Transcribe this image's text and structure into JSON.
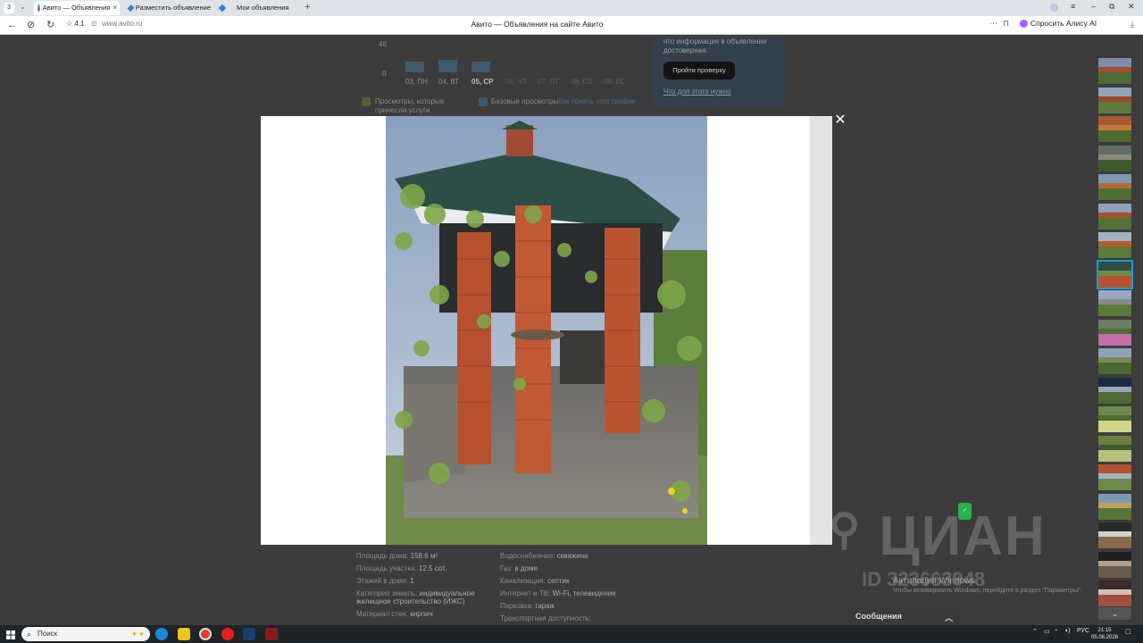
{
  "browser": {
    "tab_count": "3",
    "tabs": [
      {
        "label": "Авито — Объявления",
        "active": true
      },
      {
        "label": "Разместить объявление"
      },
      {
        "label": "Мои объявления"
      }
    ],
    "rating": "4.1",
    "url": "www.avito.ru",
    "page_title": "Авито — Объявления на сайте Авито",
    "alice_label": "Спросить Алису AI"
  },
  "background_page": {
    "chart_y_top": "46",
    "chart_y_zero": "0",
    "days": [
      "03, ПН",
      "04, ВТ",
      "05, СР",
      "06, ЧТ",
      "07, ПТ",
      "08, СБ",
      "09, ВС"
    ],
    "legend_paid": "Просмотры, которые принесли услуги",
    "legend_base": "Базовые просмотры",
    "legend_link": "Как понять этот график",
    "tip_text": "что информация в объявлении достоверная.",
    "check_button": "Пройти проверку",
    "check_link": "Что для этого нужно",
    "specs_left": [
      {
        "label": "Площадь дома:",
        "value": "158.6 м²"
      },
      {
        "label": "Площадь участка:",
        "value": "12.5 сот."
      },
      {
        "label": "Этажей в доме:",
        "value": "1"
      },
      {
        "label": "Категория земель:",
        "value": "индивидуальное жилищное строительство (ИЖС)"
      },
      {
        "label": "Материал стен:",
        "value": "кирпич"
      }
    ],
    "specs_right": [
      {
        "label": "Водоснабжение:",
        "value": "скважина"
      },
      {
        "label": "Газ:",
        "value": "в доме"
      },
      {
        "label": "Канализация:",
        "value": "септик"
      },
      {
        "label": "Интернет и ТВ:",
        "value": "Wi-Fi, телевидение"
      },
      {
        "label": "Парковка:",
        "value": "гараж"
      },
      {
        "label": "Транспортная доступность:",
        "value": ""
      }
    ]
  },
  "overlay": {
    "cian_watermark": "ЦИАН",
    "cian_id": "ID 323663948",
    "windows_activation": "Активация Windows",
    "windows_activation_sub": "Чтобы активировать Windows, перейдите в раздел \"Параметры\".",
    "messages_label": "Сообщения"
  },
  "taskbar": {
    "search_label": "Поиск",
    "lang": "РУС",
    "time": "21:15",
    "date": "05.08.2026"
  },
  "thumbnails": {
    "count": 19,
    "selected_index": 7
  }
}
